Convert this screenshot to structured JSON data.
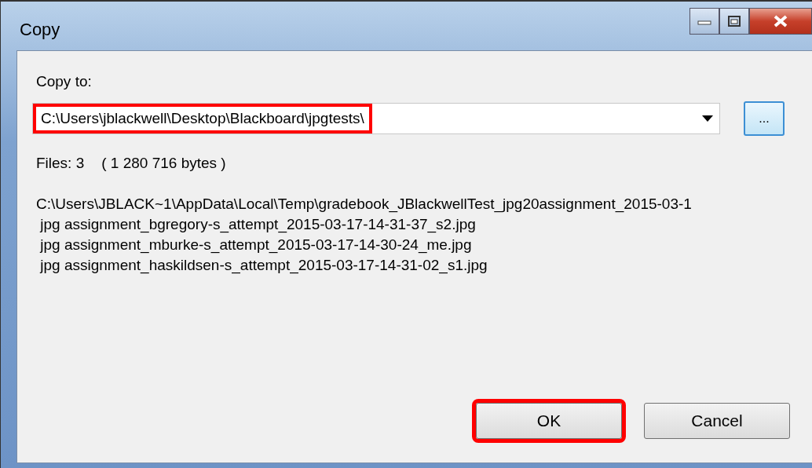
{
  "window": {
    "title": "Copy"
  },
  "copy_to": {
    "label": "Copy to:",
    "value": "C:\\Users\\jblackwell\\Desktop\\Blackboard\\jpgtests\\",
    "highlighted": true
  },
  "browse_button": {
    "label": "..."
  },
  "summary": {
    "files": "Files: 3",
    "bytes": "( 1 280 716 bytes )"
  },
  "listing": [
    "C:\\Users\\JBLACK~1\\AppData\\Local\\Temp\\gradebook_JBlackwellTest_jpg20assignment_2015-03-1",
    " jpg assignment_bgregory-s_attempt_2015-03-17-14-31-37_s2.jpg",
    " jpg assignment_mburke-s_attempt_2015-03-17-14-30-24_me.jpg",
    " jpg assignment_haskildsen-s_attempt_2015-03-17-14-31-02_s1.jpg"
  ],
  "buttons": [
    {
      "label": "OK",
      "highlighted": true
    },
    {
      "label": "Cancel",
      "highlighted": false
    }
  ]
}
